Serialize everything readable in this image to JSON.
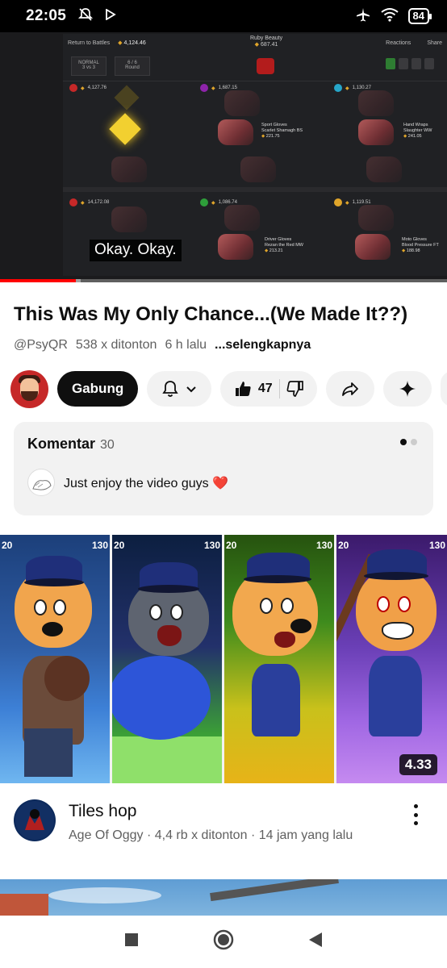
{
  "status_bar": {
    "time": "22:05",
    "battery": "84",
    "icons": [
      "bell-off-icon",
      "play-store-icon",
      "airplane-icon",
      "wifi-icon",
      "battery-icon"
    ]
  },
  "player": {
    "caption": "Okay. Okay.",
    "progress": 0.17,
    "buffered": 0.18,
    "game": {
      "return": "Return to Battles",
      "balance": "4,124.46",
      "mode_label": "Ruby Beauty",
      "mode_value": "687.41",
      "reactions": "Reactions",
      "share": "Share",
      "mode": "NORMAL",
      "mode_sub": "3 vs 3",
      "round": "6 / 6",
      "round_label": "Round",
      "slots": [
        {
          "value": "4,127.76",
          "color": "#c62828"
        },
        {
          "value": "1,687.15",
          "color": "#8e24aa",
          "item_cat": "Sport Gloves",
          "item_name": "Scarlet Shamagh BS",
          "item_price": "221.75"
        },
        {
          "value": "1,130.27",
          "color": "#26a6c9",
          "item_cat": "Hand Wraps",
          "item_name": "Slaughter WW",
          "item_price": "241.05"
        },
        {
          "value": "14,172.08",
          "color": "#c62828"
        },
        {
          "value": "1,086.74",
          "color": "#2e9e3a",
          "item_cat": "Driver Gloves",
          "item_name": "Rezan the Red MW",
          "item_price": "213.21"
        },
        {
          "value": "1,119.51",
          "color": "#e0a52a",
          "item_cat": "Moto Gloves",
          "item_name": "Blood Pressure FT",
          "item_price": "188.98"
        }
      ]
    }
  },
  "video": {
    "title": "This Was My Only Chance...(We Made It??)",
    "channel": "@PsyQR",
    "views": "538 x ditonton",
    "age": "6 h lalu",
    "more": "...selengkapnya"
  },
  "actions": {
    "join": "Gabung",
    "likes": "47"
  },
  "comments": {
    "header": "Komentar",
    "count": "30",
    "top_comment": "Just enjoy the video guys ❤️"
  },
  "recommended": {
    "duration": "4.33",
    "hud_left": "20",
    "hud_right": "130",
    "title": "Tiles hop",
    "channel": "Age Of Oggy",
    "views": "4,4 rb x ditonton",
    "age": "14 jam yang lalu"
  },
  "colors": {
    "accent_red": "#ff0000",
    "join_bg": "#0f0f0f",
    "pill_bg": "#f2f2f2"
  }
}
